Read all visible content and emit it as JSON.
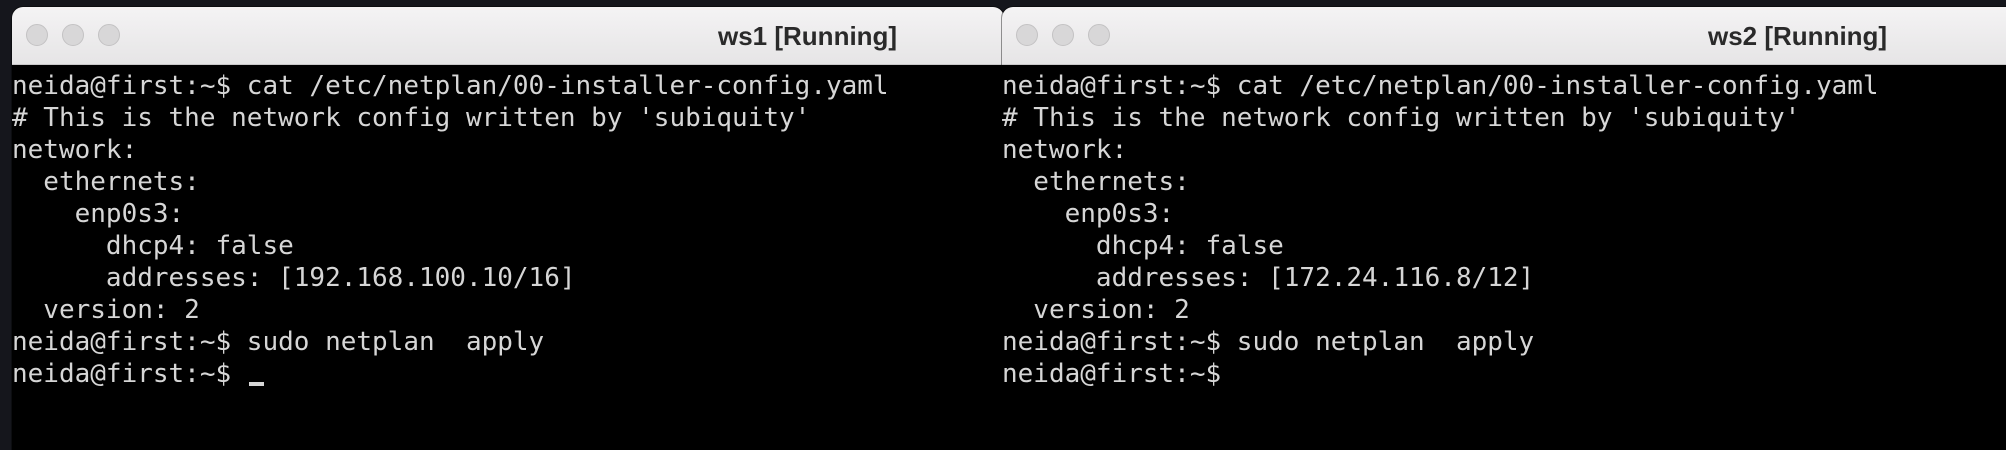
{
  "windows": [
    {
      "title": "ws1 [Running]",
      "lines": [
        "neida@first:~$ cat /etc/netplan/00-installer-config.yaml",
        "# This is the network config written by 'subiquity'",
        "network:",
        "  ethernets:",
        "    enp0s3:",
        "      dhcp4: false",
        "      addresses: [192.168.100.10/16]",
        "  version: 2",
        "neida@first:~$ sudo netplan  apply",
        "neida@first:~$ "
      ]
    },
    {
      "title": "ws2 [Running]",
      "lines": [
        "neida@first:~$ cat /etc/netplan/00-installer-config.yaml",
        "# This is the network config written by 'subiquity'",
        "network:",
        "  ethernets:",
        "    enp0s3:",
        "      dhcp4: false",
        "      addresses: [172.24.116.8/12]",
        "  version: 2",
        "neida@first:~$ sudo netplan  apply",
        "neida@first:~$"
      ]
    }
  ],
  "colors": {
    "terminal_bg": "#000000",
    "terminal_fg": "#d6d6d6",
    "titlebar_bg": "#ececec"
  }
}
